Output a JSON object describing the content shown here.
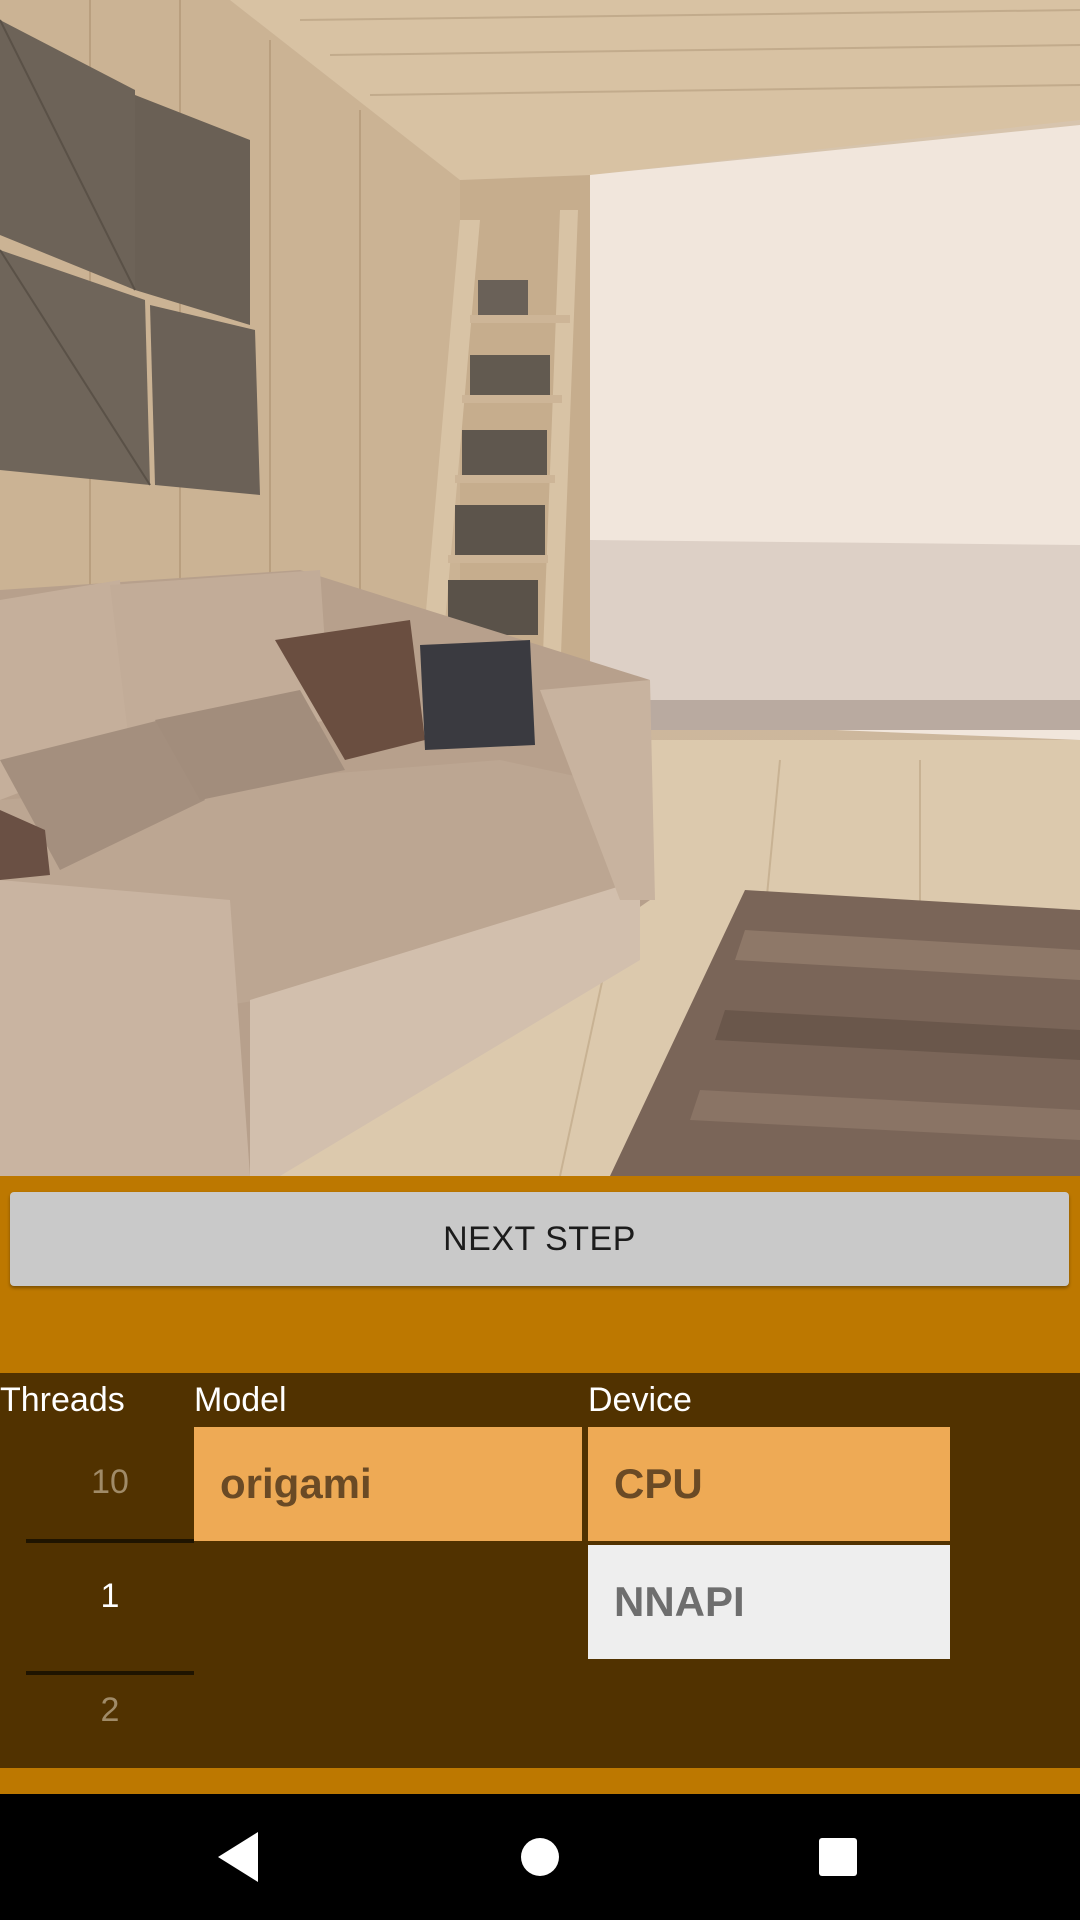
{
  "actions": {
    "next_step_label": "NEXT STEP"
  },
  "settings": {
    "threads": {
      "label": "Threads",
      "values": [
        "10",
        "1",
        "2"
      ],
      "selected": "1"
    },
    "model": {
      "label": "Model",
      "options": [
        {
          "label": "origami",
          "selected": true
        }
      ]
    },
    "device": {
      "label": "Device",
      "options": [
        {
          "label": "CPU",
          "selected": true
        },
        {
          "label": "NNAPI",
          "selected": false
        }
      ]
    }
  },
  "navigation": {
    "icons": [
      "back-icon",
      "home-icon",
      "recents-icon"
    ]
  },
  "colors": {
    "band_orange": "#bd7800",
    "panel_brown": "#513200",
    "option_selected": "#eeaa55",
    "option_unselected": "#eeeeee",
    "button_gray": "#c9c9c9"
  }
}
